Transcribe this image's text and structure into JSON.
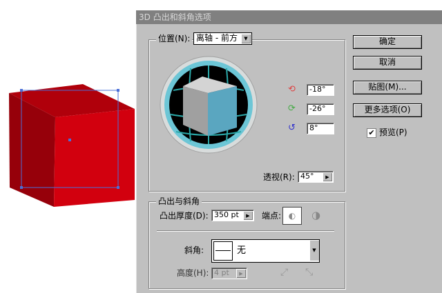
{
  "dialog": {
    "title": "3D 凸出和斜角选项"
  },
  "position": {
    "label": "位置(N):",
    "value": "离轴 - 前方"
  },
  "rotation": {
    "x": "-18°",
    "y": "-26°",
    "z": "8°"
  },
  "perspective": {
    "label": "透视(R):",
    "value": "45°"
  },
  "buttons": {
    "ok": "确定",
    "cancel": "取消",
    "map": "贴图(M)...",
    "more": "更多选项(O)"
  },
  "preview": {
    "label": "预览(P)",
    "checked": true
  },
  "extrude": {
    "legend": "凸出与斜角",
    "depth_label": "凸出厚度(D):",
    "depth_value": "350 pt",
    "cap_label": "端点:",
    "bevel_label": "斜角:",
    "bevel_value": "无",
    "height_label": "高度(H):",
    "height_value": "4 pt"
  },
  "colors": {
    "cube_front": "#d2000e",
    "cube_side": "#9c0008",
    "cube_top": "#b8000b",
    "selection": "#4a6fd8"
  }
}
